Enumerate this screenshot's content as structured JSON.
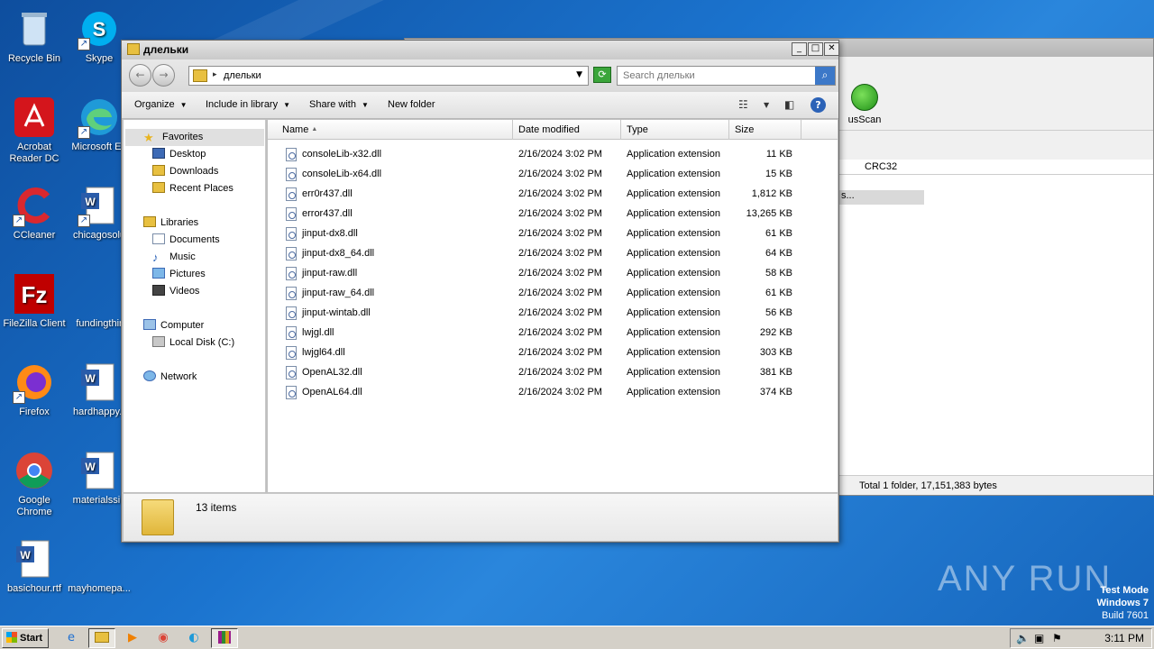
{
  "desktop": {
    "icons": [
      {
        "label": "Recycle Bin"
      },
      {
        "label": "Skype"
      },
      {
        "label": "Acrobat Reader DC"
      },
      {
        "label": "Microsoft Ed"
      },
      {
        "label": "CCleaner"
      },
      {
        "label": "chicagosolu"
      },
      {
        "label": "FileZilla Client"
      },
      {
        "label": "fundingthir"
      },
      {
        "label": "Firefox"
      },
      {
        "label": "hardhappy.r"
      },
      {
        "label": "Google Chrome"
      },
      {
        "label": "materialssin"
      },
      {
        "label": "basichour.rtf"
      },
      {
        "label": "mayhomepa..."
      }
    ]
  },
  "background_window": {
    "toolbar_label": "usScan",
    "column": "CRC32",
    "row_text": "s...",
    "status": "Total 1 folder, 17,151,383 bytes"
  },
  "explorer": {
    "title": "длельки",
    "address_path": "длельки",
    "search_placeholder": "Search длельки",
    "commands": {
      "organize": "Organize",
      "include": "Include in library",
      "share": "Share with",
      "new_folder": "New folder"
    },
    "nav": {
      "favorites": "Favorites",
      "desktop": "Desktop",
      "downloads": "Downloads",
      "recent": "Recent Places",
      "libraries": "Libraries",
      "documents": "Documents",
      "music": "Music",
      "pictures": "Pictures",
      "videos": "Videos",
      "computer": "Computer",
      "local_disk": "Local Disk (C:)",
      "network": "Network"
    },
    "columns": {
      "name": "Name",
      "date": "Date modified",
      "type": "Type",
      "size": "Size"
    },
    "files": [
      {
        "name": "consoleLib-x32.dll",
        "date": "2/16/2024 3:02 PM",
        "type": "Application extension",
        "size": "11 KB"
      },
      {
        "name": "consoleLib-x64.dll",
        "date": "2/16/2024 3:02 PM",
        "type": "Application extension",
        "size": "15 KB"
      },
      {
        "name": "err0r437.dll",
        "date": "2/16/2024 3:02 PM",
        "type": "Application extension",
        "size": "1,812 KB"
      },
      {
        "name": "error437.dll",
        "date": "2/16/2024 3:02 PM",
        "type": "Application extension",
        "size": "13,265 KB"
      },
      {
        "name": "jinput-dx8.dll",
        "date": "2/16/2024 3:02 PM",
        "type": "Application extension",
        "size": "61 KB"
      },
      {
        "name": "jinput-dx8_64.dll",
        "date": "2/16/2024 3:02 PM",
        "type": "Application extension",
        "size": "64 KB"
      },
      {
        "name": "jinput-raw.dll",
        "date": "2/16/2024 3:02 PM",
        "type": "Application extension",
        "size": "58 KB"
      },
      {
        "name": "jinput-raw_64.dll",
        "date": "2/16/2024 3:02 PM",
        "type": "Application extension",
        "size": "61 KB"
      },
      {
        "name": "jinput-wintab.dll",
        "date": "2/16/2024 3:02 PM",
        "type": "Application extension",
        "size": "56 KB"
      },
      {
        "name": "lwjgl.dll",
        "date": "2/16/2024 3:02 PM",
        "type": "Application extension",
        "size": "292 KB"
      },
      {
        "name": "lwjgl64.dll",
        "date": "2/16/2024 3:02 PM",
        "type": "Application extension",
        "size": "303 KB"
      },
      {
        "name": "OpenAL32.dll",
        "date": "2/16/2024 3:02 PM",
        "type": "Application extension",
        "size": "381 KB"
      },
      {
        "name": "OpenAL64.dll",
        "date": "2/16/2024 3:02 PM",
        "type": "Application extension",
        "size": "374 KB"
      }
    ],
    "item_count": "13 items"
  },
  "watermark": {
    "text": "ANY RUN",
    "test_mode": "Test Mode",
    "os": "Windows 7",
    "build": "Build 7601"
  },
  "taskbar": {
    "start": "Start",
    "clock": "3:11 PM"
  }
}
